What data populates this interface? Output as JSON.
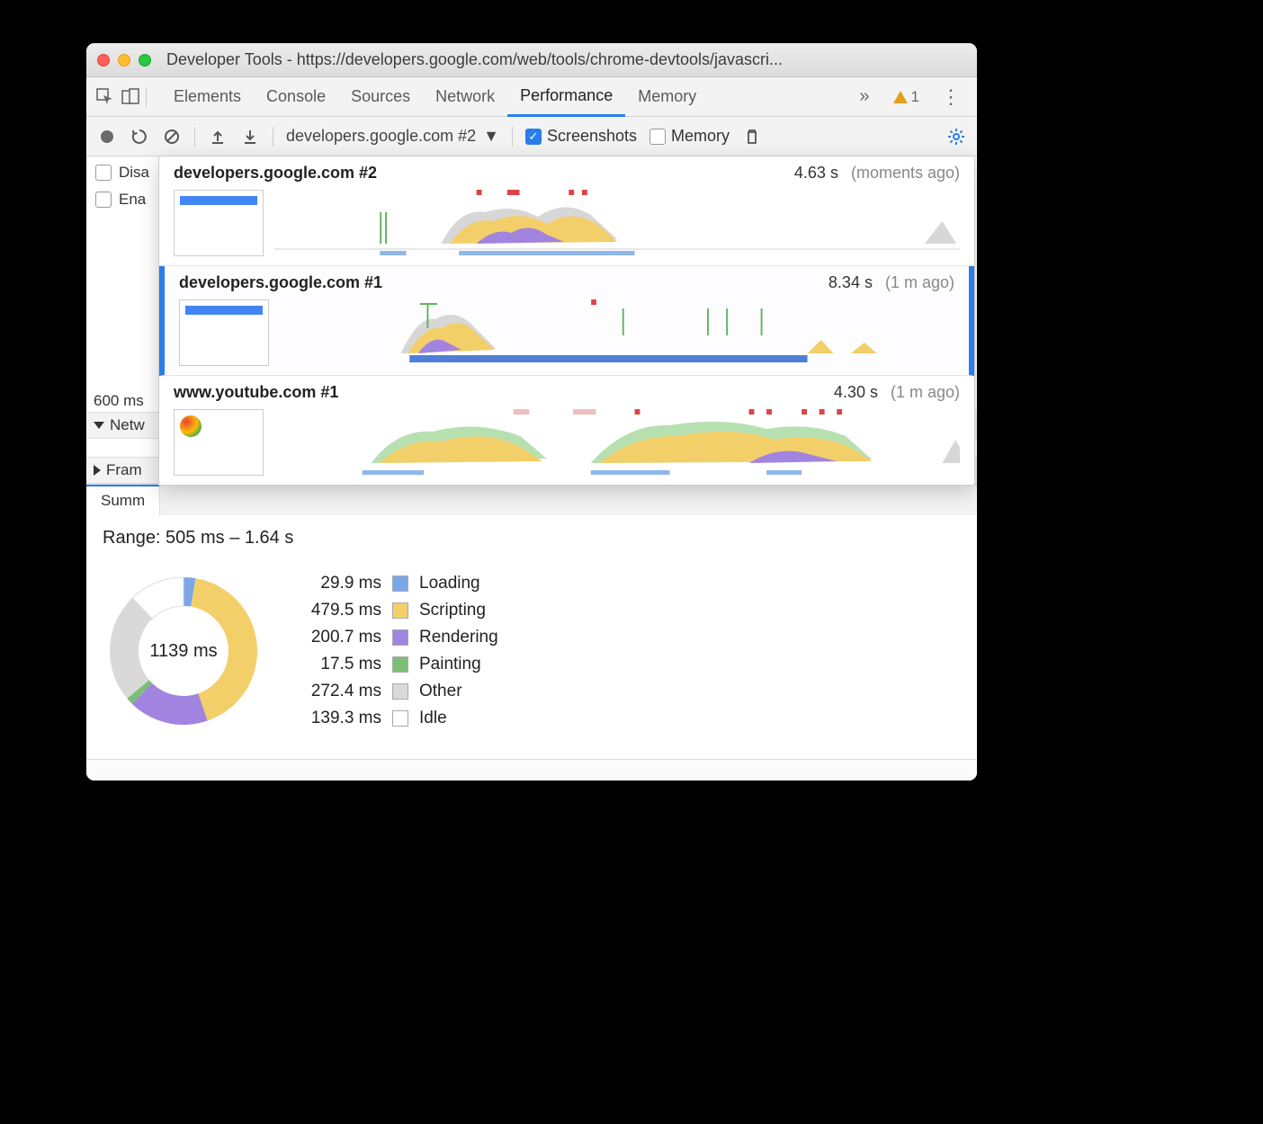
{
  "window": {
    "title": "Developer Tools - https://developers.google.com/web/tools/chrome-devtools/javascri..."
  },
  "tabs": {
    "items": [
      "Elements",
      "Console",
      "Sources",
      "Network",
      "Performance",
      "Memory"
    ],
    "active": "Performance",
    "warning_count": "1"
  },
  "toolbar": {
    "recording_name": "developers.google.com #2",
    "screenshots_label": "Screenshots",
    "memory_label": "Memory"
  },
  "left": {
    "disable_label": "Disa",
    "enable_label": "Ena",
    "time_marker": "600 ms",
    "network_label": "Netw",
    "frames_label": "Fram"
  },
  "recordings": [
    {
      "title": "developers.google.com #2",
      "duration": "4.63 s",
      "when": "(moments ago)",
      "selected": false
    },
    {
      "title": "developers.google.com #1",
      "duration": "8.34 s",
      "when": "(1 m ago)",
      "selected": true
    },
    {
      "title": "www.youtube.com #1",
      "duration": "4.30 s",
      "when": "(1 m ago)",
      "selected": false
    }
  ],
  "summary": {
    "tab_label": "Summ",
    "range_label": "Range: 505 ms – 1.64 s",
    "total": "1139 ms"
  },
  "chart_data": {
    "type": "pie",
    "title": "",
    "series": [
      {
        "name": "Loading",
        "value_ms": 29.9,
        "color": "#7aa7e8",
        "label": "29.9 ms"
      },
      {
        "name": "Scripting",
        "value_ms": 479.5,
        "color": "#f3cf6a",
        "label": "479.5 ms"
      },
      {
        "name": "Rendering",
        "value_ms": 200.7,
        "color": "#a184e0",
        "label": "200.7 ms"
      },
      {
        "name": "Painting",
        "value_ms": 17.5,
        "color": "#7bbf77",
        "label": "17.5 ms"
      },
      {
        "name": "Other",
        "value_ms": 272.4,
        "color": "#d9d9d9",
        "label": "272.4 ms"
      },
      {
        "name": "Idle",
        "value_ms": 139.3,
        "color": "#ffffff",
        "label": "139.3 ms"
      }
    ],
    "total_ms": 1139
  }
}
